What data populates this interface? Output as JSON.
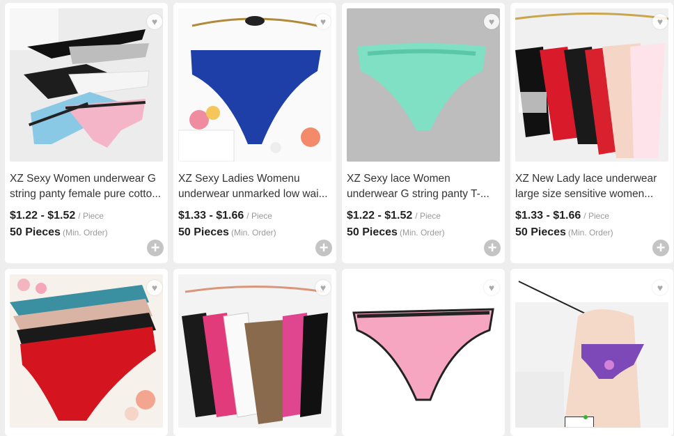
{
  "products": [
    {
      "title_line1": "XZ Sexy Women underwear G",
      "title_line2": "string panty female pure cotto...",
      "price": "$1.22 - $1.52",
      "price_unit": "/ Piece",
      "moq": "50 Pieces",
      "moq_unit": "(Min. Order)"
    },
    {
      "title_line1": "XZ Sexy Ladies Womenu",
      "title_line2": "underwear unmarked low wai...",
      "price": "$1.33 - $1.66",
      "price_unit": "/ Piece",
      "moq": "50 Pieces",
      "moq_unit": "(Min. Order)"
    },
    {
      "title_line1": "XZ Sexy lace Women",
      "title_line2": "underwear G string panty T-...",
      "price": "$1.22 - $1.52",
      "price_unit": "/ Piece",
      "moq": "50 Pieces",
      "moq_unit": "(Min. Order)"
    },
    {
      "title_line1": "XZ New Lady lace underwear",
      "title_line2": "large size sensitive women...",
      "price": "$1.33 - $1.66",
      "price_unit": "/ Piece",
      "moq": "50 Pieces",
      "moq_unit": "(Min. Order)"
    }
  ],
  "icons": {
    "favorite": "heart-icon",
    "add": "plus-circle-icon"
  },
  "colors": {
    "card_bg": "#ffffff",
    "page_bg": "#eeeeee",
    "add_button": "#c4c4c4"
  }
}
